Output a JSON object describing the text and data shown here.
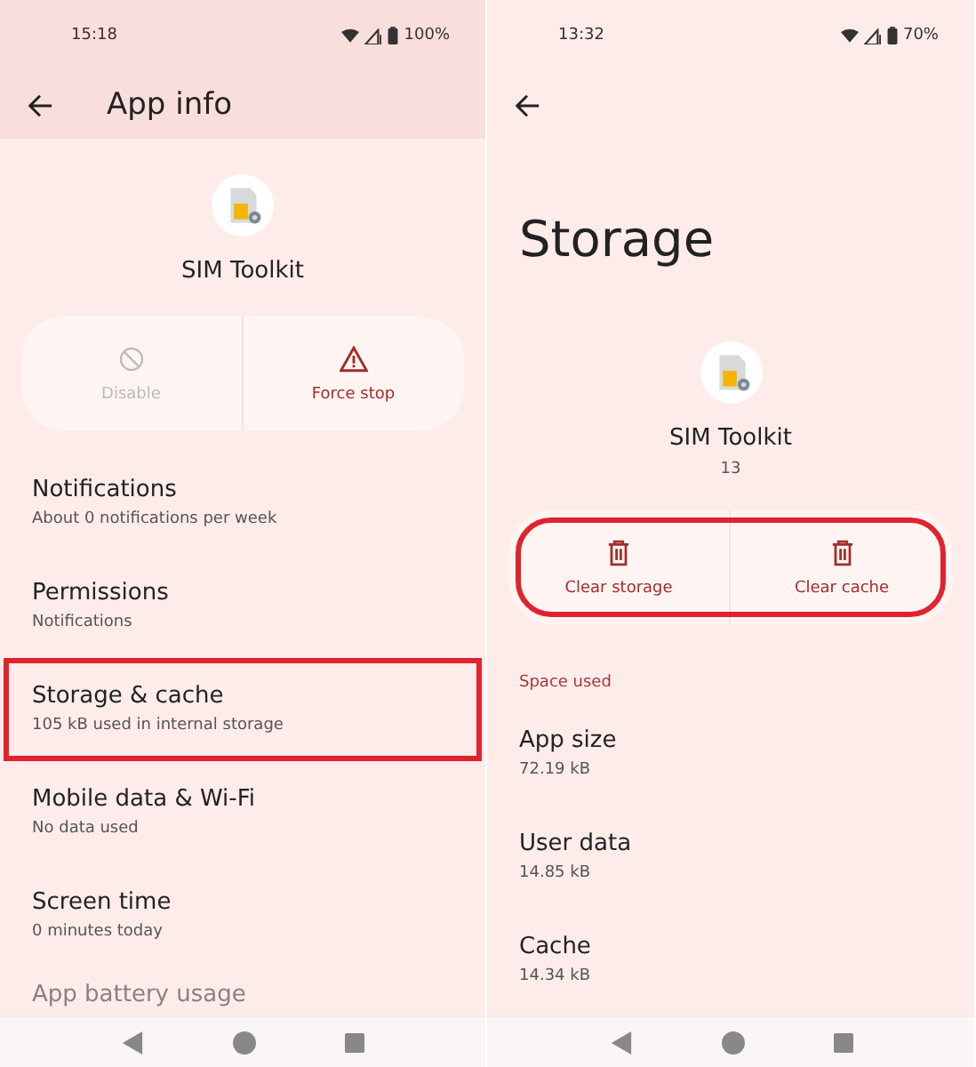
{
  "screens": [
    {
      "status_bar": {
        "time": "15:18",
        "battery": "100%"
      },
      "app_bar": {
        "title": "App info"
      },
      "app": {
        "name": "SIM Toolkit"
      },
      "actions": [
        {
          "label": "Disable",
          "kind": "disable",
          "disabled": true
        },
        {
          "label": "Force stop",
          "kind": "stop",
          "disabled": false
        }
      ],
      "actions_highlighted": false,
      "items": [
        {
          "title": "Notifications",
          "subtitle": "About 0 notifications per week",
          "highlighted": false,
          "faded": false
        },
        {
          "title": "Permissions",
          "subtitle": "Notifications",
          "highlighted": false,
          "faded": false
        },
        {
          "title": "Storage & cache",
          "subtitle": "105 kB used in internal storage",
          "highlighted": true,
          "faded": false
        },
        {
          "title": "Mobile data & Wi-Fi",
          "subtitle": "No data used",
          "highlighted": false,
          "faded": false
        },
        {
          "title": "Screen time",
          "subtitle": "0 minutes today",
          "highlighted": false,
          "faded": false
        },
        {
          "title": "App battery usage",
          "highlighted": false,
          "faded": true
        }
      ]
    },
    {
      "status_bar": {
        "time": "13:32",
        "battery": "70%"
      },
      "page_title": "Storage",
      "app": {
        "name": "SIM Toolkit",
        "version": "13"
      },
      "actions": [
        {
          "label": "Clear storage",
          "kind": "clear",
          "disabled": false
        },
        {
          "label": "Clear cache",
          "kind": "clear",
          "disabled": false
        }
      ],
      "actions_highlighted": true,
      "section": "Space used",
      "items": [
        {
          "title": "App size",
          "subtitle": "72.19 kB",
          "highlighted": false,
          "faded": false
        },
        {
          "title": "User data",
          "subtitle": "14.85 kB",
          "highlighted": false,
          "faded": false
        },
        {
          "title": "Cache",
          "subtitle": "14.34 kB",
          "highlighted": false,
          "faded": false
        }
      ]
    }
  ]
}
